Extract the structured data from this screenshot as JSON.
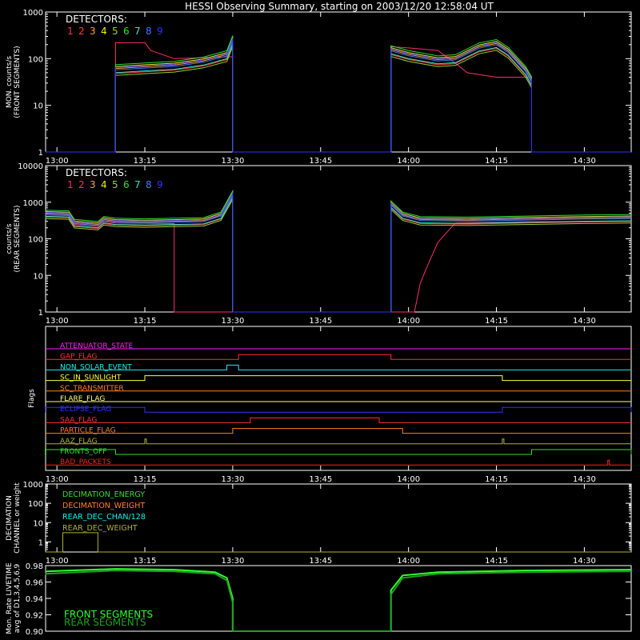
{
  "title": "HESSI Observing Summary, starting on 2003/12/20 12:58:04 UT",
  "colors": {
    "background": "#000000",
    "axes": "#ffffff",
    "detectors": [
      "#ff2a6e",
      "#ff3a3a",
      "#ff9b3a",
      "#f0f000",
      "#9acd32",
      "#2fe02f",
      "#30e8c8",
      "#3a7aff",
      "#3030ff"
    ],
    "flags": [
      "#ff22ff",
      "#ff3030",
      "#18f0f0",
      "#ffff30",
      "#ff8020",
      "#ffff80",
      "#3030ff",
      "#ff3030",
      "#ff8020",
      "#b0b030",
      "#30e030",
      "#ff2020"
    ],
    "decimation": [
      "#30e030",
      "#ff8020",
      "#18f0f0",
      "#b0b030"
    ],
    "livetime": [
      "#30ff30",
      "#20a020"
    ]
  },
  "chart_data": [
    {
      "type": "line",
      "name": "front",
      "ylabel": "MON. counts/s (FRONT SEGMENTS)",
      "ylabel_lines": [
        "MON. counts/s",
        "(FRONT SEGMENTS)"
      ],
      "yscale": "log",
      "ylim": [
        1,
        1000
      ],
      "yticks": [
        "1",
        "10",
        "100",
        "1000"
      ],
      "xlim": [
        "12:58:04",
        "14:38:00"
      ],
      "xticks": [
        "13:00",
        "13:15",
        "13:30",
        "13:45",
        "14:00",
        "14:15",
        "14:30"
      ],
      "legend_title": "DETECTORS:",
      "legend": [
        "1",
        "2",
        "3",
        "4",
        "5",
        "6",
        "7",
        "8",
        "9"
      ],
      "series_points": [
        [
          "12:58",
          1
        ],
        [
          "13:10",
          1
        ],
        [
          "13:10",
          55
        ],
        [
          "13:15",
          60
        ],
        [
          "13:20",
          65
        ],
        [
          "13:25",
          80
        ],
        [
          "13:29",
          110
        ],
        [
          "13:30",
          230
        ],
        [
          "13:30",
          1
        ],
        [
          "13:57",
          1
        ],
        [
          "13:57",
          140
        ],
        [
          "14:00",
          110
        ],
        [
          "14:05",
          85
        ],
        [
          "14:08",
          90
        ],
        [
          "14:12",
          160
        ],
        [
          "14:15",
          190
        ],
        [
          "14:17",
          130
        ],
        [
          "14:20",
          50
        ],
        [
          "14:21",
          30
        ],
        [
          "14:21",
          1
        ],
        [
          "14:38",
          1
        ]
      ],
      "detector1_points": [
        [
          "12:58",
          1
        ],
        [
          "13:10",
          1
        ],
        [
          "13:10",
          220
        ],
        [
          "13:15",
          220
        ],
        [
          "13:16",
          150
        ],
        [
          "13:20",
          100
        ],
        [
          "13:30",
          110
        ],
        [
          "13:30",
          1
        ],
        [
          "13:57",
          1
        ],
        [
          "13:57",
          180
        ],
        [
          "14:00",
          170
        ],
        [
          "14:05",
          150
        ],
        [
          "14:08",
          80
        ],
        [
          "14:10",
          50
        ],
        [
          "14:15",
          40
        ],
        [
          "14:21",
          40
        ],
        [
          "14:21",
          1
        ],
        [
          "14:38",
          1
        ]
      ]
    },
    {
      "type": "line",
      "name": "rear",
      "ylabel": "counts/s (REAR SEGMENTS)",
      "ylabel_lines": [
        "counts/s",
        "(REAR SEGMENTS)"
      ],
      "yscale": "log",
      "ylim": [
        1,
        10000
      ],
      "yticks": [
        "1",
        "10",
        "100",
        "1000",
        "10000"
      ],
      "xlim": [
        "12:58:04",
        "14:38:00"
      ],
      "xticks": [
        "13:00",
        "13:15",
        "13:30",
        "13:45",
        "14:00",
        "14:15",
        "14:30"
      ],
      "legend_title": "DETECTORS:",
      "legend": [
        "1",
        "2",
        "3",
        "4",
        "5",
        "6",
        "7",
        "8",
        "9"
      ],
      "series_points": [
        [
          "12:58",
          450
        ],
        [
          "13:02",
          430
        ],
        [
          "13:03",
          250
        ],
        [
          "13:07",
          220
        ],
        [
          "13:08",
          300
        ],
        [
          "13:10",
          270
        ],
        [
          "13:15",
          260
        ],
        [
          "13:20",
          270
        ],
        [
          "13:25",
          280
        ],
        [
          "13:28",
          400
        ],
        [
          "13:30",
          1500
        ],
        [
          "13:30",
          1
        ],
        [
          "13:57",
          1
        ],
        [
          "13:57",
          800
        ],
        [
          "13:59",
          400
        ],
        [
          "14:02",
          300
        ],
        [
          "14:10",
          290
        ],
        [
          "14:20",
          310
        ],
        [
          "14:30",
          330
        ],
        [
          "14:38",
          340
        ]
      ],
      "detector1_points": [
        [
          "12:58",
          450
        ],
        [
          "13:02",
          430
        ],
        [
          "13:03",
          250
        ],
        [
          "13:07",
          220
        ],
        [
          "13:08",
          300
        ],
        [
          "13:10",
          270
        ],
        [
          "13:20",
          260
        ],
        [
          "13:20",
          1
        ],
        [
          "14:01",
          1
        ],
        [
          "14:02",
          6
        ],
        [
          "14:03",
          15
        ],
        [
          "14:05",
          80
        ],
        [
          "14:07",
          180
        ],
        [
          "14:08",
          270
        ],
        [
          "14:20",
          290
        ],
        [
          "14:30",
          300
        ],
        [
          "14:38",
          300
        ]
      ]
    },
    {
      "type": "table",
      "name": "flags",
      "ylabel": "Flags",
      "xlim": [
        "12:58:04",
        "14:38:00"
      ],
      "xticks": [
        "13:00",
        "13:15",
        "13:30",
        "13:45",
        "14:00",
        "14:15",
        "14:30"
      ],
      "flags": [
        {
          "name": "ATTENUATOR_STATE",
          "on": []
        },
        {
          "name": "GAP_FLAG",
          "on": [
            [
              "13:31",
              "13:57"
            ]
          ]
        },
        {
          "name": "NON_SOLAR_EVENT",
          "on": [
            [
              "13:29",
              "13:31"
            ]
          ]
        },
        {
          "name": "SC_IN_SUNLIGHT",
          "on": [
            [
              "13:15",
              "14:16"
            ]
          ]
        },
        {
          "name": "SC_TRANSMITTER",
          "on": []
        },
        {
          "name": "FLARE_FLAG",
          "on": []
        },
        {
          "name": "ECLIPSE_FLAG",
          "on": [
            [
              "12:58",
              "13:15"
            ],
            [
              "14:16",
              "14:38"
            ]
          ]
        },
        {
          "name": "SAA_FLAG",
          "on": [
            [
              "13:33",
              "13:55"
            ]
          ]
        },
        {
          "name": "PARTICLE_FLAG",
          "on": [
            [
              "13:30",
              "13:59"
            ]
          ]
        },
        {
          "name": "AAZ_FLAG",
          "on": [
            [
              "13:15",
              "13:15"
            ],
            [
              "14:16",
              "14:16"
            ]
          ]
        },
        {
          "name": "FRONTS_OFF",
          "on": [
            [
              "12:58",
              "13:10"
            ],
            [
              "14:21",
              "14:38"
            ]
          ]
        },
        {
          "name": "BAD_PACKETS",
          "on": [
            [
              "14:34",
              "14:34"
            ]
          ]
        }
      ]
    },
    {
      "type": "line",
      "name": "decimation",
      "ylabel": "DECIMATION CHANNEL or weight",
      "ylabel_lines": [
        "DECIMATION",
        "CHANNEL or weight"
      ],
      "yscale": "log",
      "ylim": [
        0.3,
        1000
      ],
      "yticks": [
        "1",
        "10",
        "100",
        "1000"
      ],
      "xlim": [
        "12:58:04",
        "14:38:00"
      ],
      "xticks": [
        "13:00",
        "13:15",
        "13:30",
        "13:45",
        "14:00",
        "14:15",
        "14:30"
      ],
      "legend": [
        "DECIMATION_ENERGY",
        "DECIMATION_WEIGHT",
        "REAR_DEC_CHAN/128",
        "REAR_DEC_WEIGHT"
      ],
      "series_points": [
        [
          "12:58",
          0.3
        ],
        [
          "13:01",
          0.3
        ],
        [
          "13:01",
          3
        ],
        [
          "13:07",
          3
        ],
        [
          "13:07",
          0.3
        ],
        [
          "14:38",
          0.3
        ]
      ]
    },
    {
      "type": "line",
      "name": "livetime",
      "ylabel": "Mon. Rate LIVETIME avg of D1,3,4,5,6,9",
      "ylabel_lines": [
        "Mon. Rate LIVETIME",
        "avg of D1,3,4,5,6,9"
      ],
      "ylim": [
        0.9,
        0.98
      ],
      "yticks": [
        "0.90",
        "0.92",
        "0.94",
        "0.96",
        "0.98"
      ],
      "xlim": [
        "12:58:04",
        "14:38:00"
      ],
      "legend": [
        "FRONT SEGMENTS",
        "REAR SEGMENTS"
      ],
      "series": [
        {
          "name": "FRONT SEGMENTS",
          "points": [
            [
              "12:58",
              0.973
            ],
            [
              "13:10",
              0.976
            ],
            [
              "13:20",
              0.975
            ],
            [
              "13:27",
              0.972
            ],
            [
              "13:29",
              0.965
            ],
            [
              "13:30",
              0.94
            ],
            [
              "13:30",
              0.9
            ],
            [
              "13:57",
              0.9
            ],
            [
              "13:57",
              0.95
            ],
            [
              "13:59",
              0.968
            ],
            [
              "14:05",
              0.972
            ],
            [
              "14:20",
              0.974
            ],
            [
              "14:38",
              0.975
            ]
          ]
        },
        {
          "name": "REAR SEGMENTS",
          "points": [
            [
              "12:58",
              0.97
            ],
            [
              "13:10",
              0.974
            ],
            [
              "13:20",
              0.973
            ],
            [
              "13:27",
              0.97
            ],
            [
              "13:29",
              0.962
            ],
            [
              "13:30",
              0.935
            ],
            [
              "13:30",
              0.9
            ],
            [
              "13:57",
              0.9
            ],
            [
              "13:57",
              0.945
            ],
            [
              "13:59",
              0.965
            ],
            [
              "14:05",
              0.97
            ],
            [
              "14:20",
              0.972
            ],
            [
              "14:38",
              0.973
            ]
          ]
        }
      ]
    }
  ]
}
